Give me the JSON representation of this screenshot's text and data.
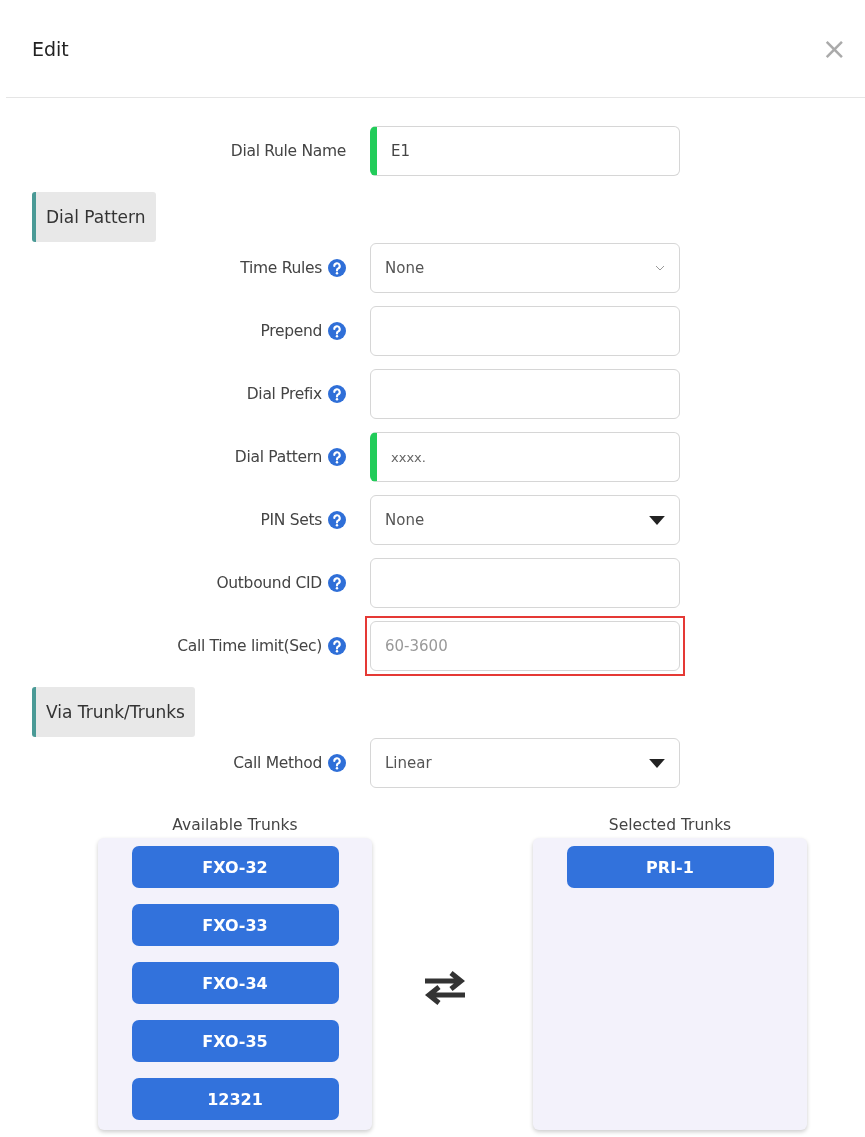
{
  "dialog": {
    "title": "Edit",
    "close": "×"
  },
  "rows": [
    {
      "kind": "input",
      "label": "Dial Rule Name",
      "help": false,
      "value": "E1",
      "required": true,
      "highlighted": false
    },
    {
      "kind": "section",
      "label": "Dial Pattern"
    },
    {
      "kind": "picker",
      "label": "Time Rules",
      "help": true,
      "value": "None",
      "required": false,
      "highlighted": false
    },
    {
      "kind": "input",
      "label": "Prepend",
      "help": true,
      "required": false,
      "highlighted": false
    },
    {
      "kind": "input",
      "label": "Dial Prefix",
      "help": true,
      "required": false,
      "highlighted": false
    },
    {
      "kind": "input",
      "label": "Dial Pattern",
      "help": true,
      "value": "xxxx.",
      "required": true,
      "highlighted": false
    },
    {
      "kind": "select",
      "label": "PIN Sets",
      "help": true,
      "value": "None",
      "required": false,
      "highlighted": false
    },
    {
      "kind": "input",
      "label": "Outbound CID",
      "help": true,
      "required": false,
      "highlighted": false
    },
    {
      "kind": "input",
      "label": "Call Time limit(Sec)",
      "help": true,
      "placeholder": "60-3600",
      "required": false,
      "highlighted": true
    },
    {
      "kind": "section",
      "label": "Via Trunk/Trunks"
    },
    {
      "kind": "select",
      "label": "Call Method",
      "help": true,
      "value": "Linear",
      "required": false,
      "highlighted": false
    }
  ],
  "available_trunks": {
    "title": "Available Trunks",
    "items": [
      "FXO-32",
      "FXO-33",
      "FXO-34",
      "FXO-35",
      "12321"
    ]
  },
  "selected_trunks": {
    "title": "Selected Trunks",
    "items": [
      "PRI-1"
    ]
  }
}
